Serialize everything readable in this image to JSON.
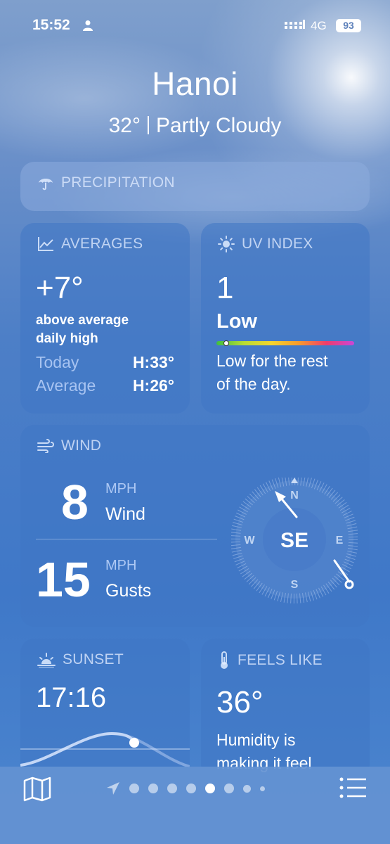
{
  "status_bar": {
    "time": "15:52",
    "network": "4G",
    "battery": "93"
  },
  "header": {
    "city": "Hanoi",
    "temperature": "32°",
    "condition": "Partly Cloudy"
  },
  "precipitation": {
    "title": "PRECIPITATION"
  },
  "averages": {
    "title": "AVERAGES",
    "value": "+7°",
    "desc_line1": "above average",
    "desc_line2": "daily high",
    "today_label": "Today",
    "today_value": "H:33°",
    "average_label": "Average",
    "average_value": "H:26°"
  },
  "uv_index": {
    "title": "UV INDEX",
    "value": "1",
    "level": "Low",
    "level_fraction": 0.05,
    "desc_line1": "Low for the rest",
    "desc_line2": "of the day."
  },
  "wind": {
    "title": "WIND",
    "speed": "8",
    "speed_unit": "MPH",
    "speed_label": "Wind",
    "gusts": "15",
    "gusts_unit": "MPH",
    "gusts_label": "Gusts",
    "direction": "SE",
    "compass_n": "N",
    "compass_e": "E",
    "compass_s": "S",
    "compass_w": "W"
  },
  "sunset": {
    "title": "SUNSET",
    "time": "17:16"
  },
  "feels_like": {
    "title": "FEELS LIKE",
    "value": "36°",
    "desc_line1": "Humidity is",
    "desc_line2": "making it feel"
  },
  "tab_bar": {
    "page_count": 8,
    "active_page": 5
  }
}
